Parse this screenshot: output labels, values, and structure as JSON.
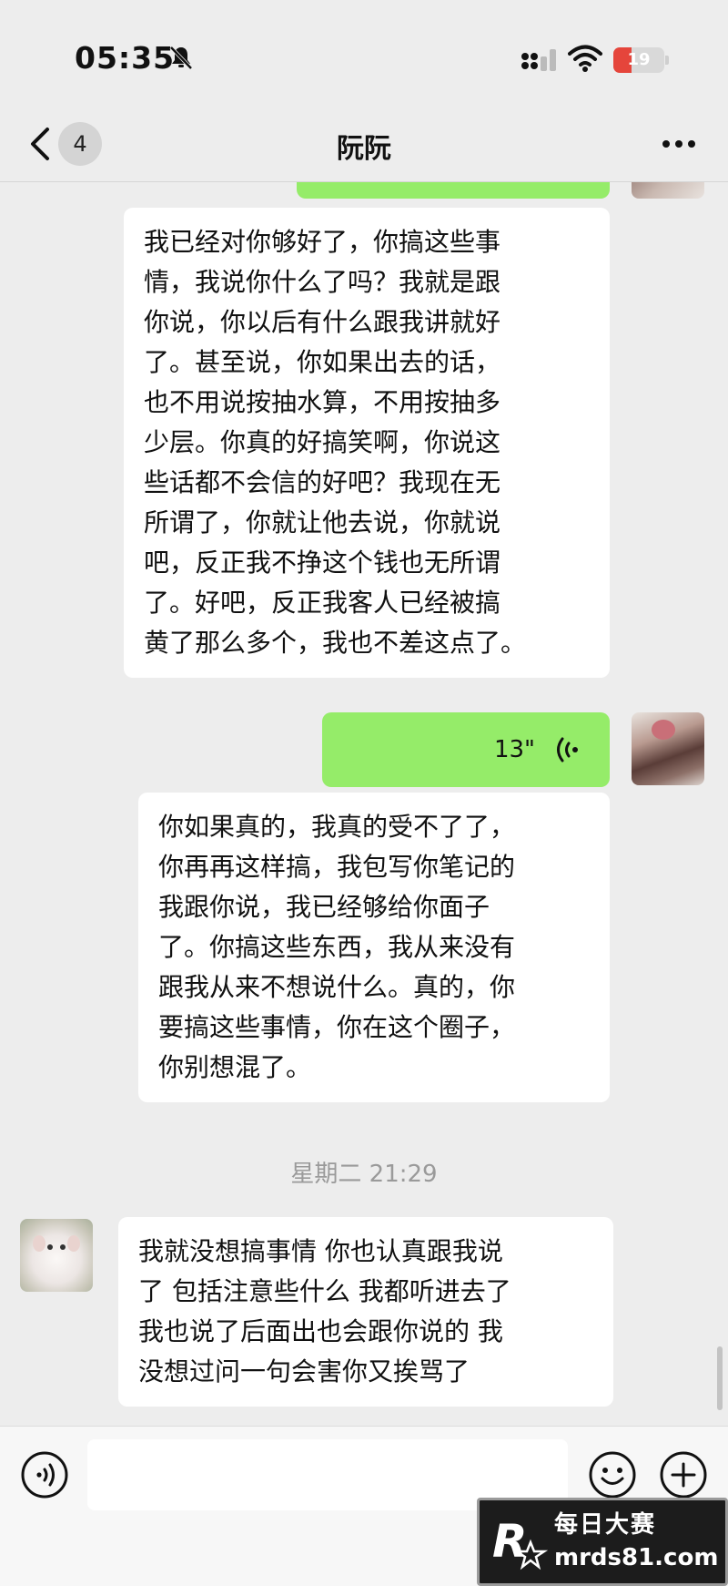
{
  "status_bar": {
    "time": "05:35",
    "battery": "19"
  },
  "nav": {
    "back_badge": "4",
    "title": "阮阮"
  },
  "messages": [
    {
      "side": "in",
      "text": "我已经对你够好了，你搞这些事\n情，我说你什么了吗？我就是跟\n你说，你以后有什么跟我讲就好\n了。甚至说，你如果出去的话，\n也不用说按抽水算，不用按抽多\n少层。你真的好搞笑啊，你说这\n些话都不会信的好吧？我现在无\n所谓了，你就让他去说，你就说\n吧，反正我不挣这个钱也无所谓\n了。好吧，反正我客人已经被搞\n黄了那么多个，我也不差这点了。"
    },
    {
      "side": "out",
      "type": "voice",
      "duration": "13\""
    },
    {
      "side": "in",
      "text": "你如果真的，我真的受不了了，\n你再再这样搞，我包写你笔记的\n我跟你说，我已经够给你面子\n了。你搞这些东西，我从来没有\n跟我从来不想说什么。真的，你\n要搞这些事情，你在这个圈子，\n你别想混了。"
    },
    {
      "type": "timestamp",
      "text": "星期二 21:29"
    },
    {
      "side": "in",
      "text": "我就没想搞事情 你也认真跟我说\n了 包括注意些什么 我都听进去了\n我也说了后面出也会跟你说的 我\n没想过问一句会害你又挨骂了"
    }
  ],
  "watermark": {
    "mark": "R",
    "name": "每日大赛",
    "url": "mrds81.com"
  },
  "colors": {
    "background": "#ededed",
    "outgoing": "#95ec69",
    "incoming": "#ffffff",
    "battery_low": "#e5453b"
  },
  "icons": [
    "bell-mute-icon",
    "signal-icon",
    "wifi-icon",
    "chevron-left-icon",
    "more-dots-icon",
    "voice-wave-icon",
    "voice-mode-icon",
    "emoji-icon",
    "plus-icon"
  ]
}
